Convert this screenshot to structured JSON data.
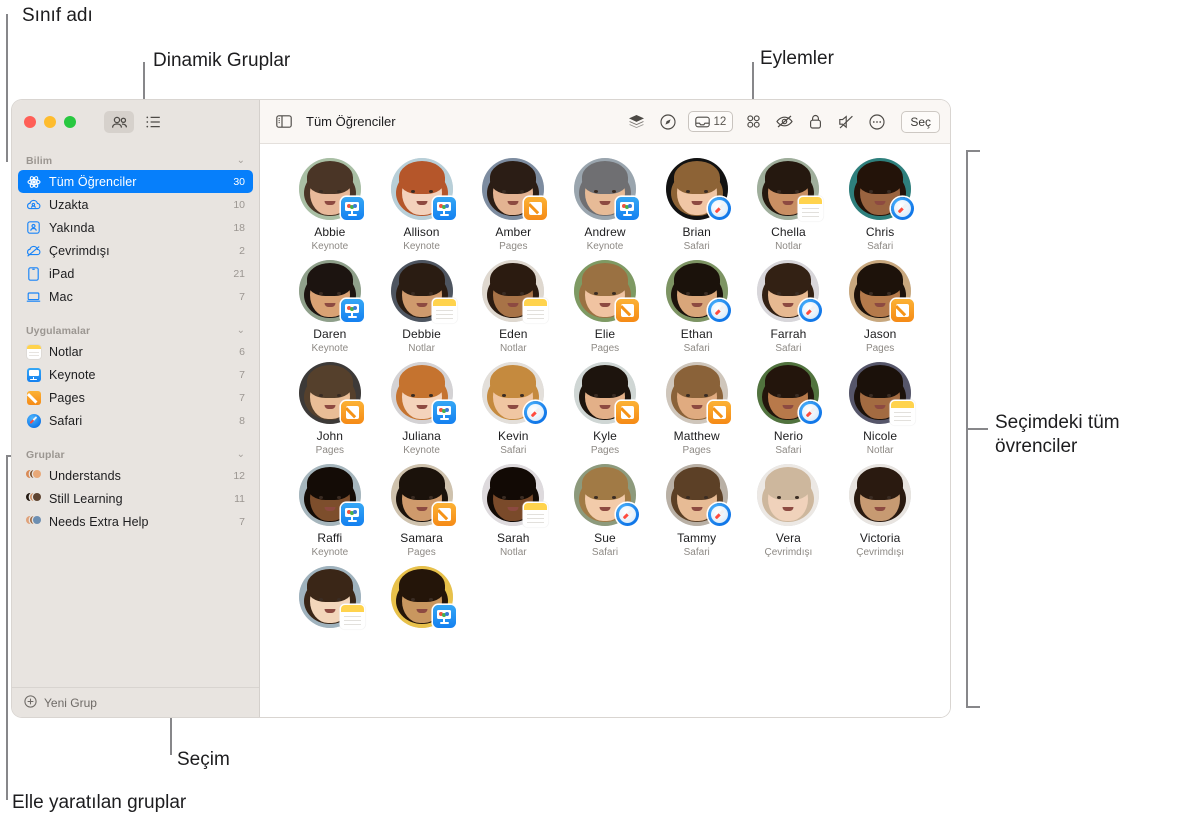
{
  "callouts": [
    {
      "id": "class-name",
      "text": "Sınıf adı"
    },
    {
      "id": "dynamic-groups",
      "text": "Dinamik Gruplar"
    },
    {
      "id": "actions",
      "text": "Eylemler"
    },
    {
      "id": "all-students-in-selection",
      "text": "Seçimdeki tüm\növrenciler"
    },
    {
      "id": "selection",
      "text": "Seçim"
    },
    {
      "id": "manual-groups",
      "text": "Elle yaratılan gruplar"
    }
  ],
  "callout_text": {
    "class_name": "Sınıf adı",
    "dynamic_groups": "Dinamik Gruplar",
    "actions": "Eylemler",
    "all_students": "Seçimdeki tüm\növrenciler",
    "selection": "Seçim",
    "manual_groups": "Elle yaratılan gruplar"
  },
  "sidebar": {
    "view_toggle": {
      "grid_icon": "people-icon",
      "list_icon": "list-icon"
    },
    "sections": [
      {
        "title": "Bilim",
        "items": [
          {
            "label": "Tüm Öğrenciler",
            "count": "30",
            "icon": "atom-icon",
            "selected": true
          },
          {
            "label": "Uzakta",
            "count": "10",
            "icon": "cloud-person-icon",
            "selected": false
          },
          {
            "label": "Yakında",
            "count": "18",
            "icon": "person-box-icon",
            "selected": false
          },
          {
            "label": "Çevrimdışı",
            "count": "2",
            "icon": "cloud-slash-icon",
            "selected": false
          },
          {
            "label": "iPad",
            "count": "21",
            "icon": "ipad-icon",
            "selected": false
          },
          {
            "label": "Mac",
            "count": "7",
            "icon": "laptop-icon",
            "selected": false
          }
        ]
      },
      {
        "title": "Uygulamalar",
        "items": [
          {
            "label": "Notlar",
            "count": "6",
            "icon": "notes-app-icon",
            "selected": false
          },
          {
            "label": "Keynote",
            "count": "7",
            "icon": "keynote-app-icon",
            "selected": false
          },
          {
            "label": "Pages",
            "count": "7",
            "icon": "pages-app-icon",
            "selected": false
          },
          {
            "label": "Safari",
            "count": "8",
            "icon": "safari-app-icon",
            "selected": false
          }
        ]
      },
      {
        "title": "Gruplar",
        "items": [
          {
            "label": "Understands",
            "count": "12",
            "icon": "group-avatars-icon",
            "selected": false
          },
          {
            "label": "Still Learning",
            "count": "11",
            "icon": "group-avatars-icon",
            "selected": false
          },
          {
            "label": "Needs Extra Help",
            "count": "7",
            "icon": "group-avatars-icon",
            "selected": false
          }
        ]
      }
    ],
    "new_group_label": "Yeni Grup",
    "new_group_icon": "plus-circle-icon"
  },
  "toolbar": {
    "sidebar_toggle_icon": "sidebar-icon",
    "title": "Tüm Öğrenciler",
    "actions": [
      {
        "name": "layers-icon",
        "label": ""
      },
      {
        "name": "navigate-icon",
        "label": ""
      },
      {
        "name": "inbox-icon",
        "label": "12"
      },
      {
        "name": "apps-grid-icon",
        "label": ""
      },
      {
        "name": "eye-slash-icon",
        "label": ""
      },
      {
        "name": "lock-icon",
        "label": ""
      },
      {
        "name": "mute-icon",
        "label": ""
      },
      {
        "name": "more-icon",
        "label": ""
      }
    ],
    "select_label": "Seç"
  },
  "students": [
    {
      "name": "Abbie",
      "app": "Keynote",
      "badge": "keynote",
      "skin": "#e8b99a",
      "hair": "#4a3526",
      "bg": "#a9bfa4"
    },
    {
      "name": "Allison",
      "app": "Keynote",
      "badge": "keynote",
      "skin": "#f3d2bc",
      "hair": "#b5562a",
      "bg": "#b8cfd8"
    },
    {
      "name": "Amber",
      "app": "Pages",
      "badge": "pages",
      "skin": "#e3b392",
      "hair": "#2b1d15",
      "bg": "#7d8ca0"
    },
    {
      "name": "Andrew",
      "app": "Keynote",
      "badge": "keynote",
      "skin": "#e7bb97",
      "hair": "#6f6f72",
      "bg": "#9aa5ae"
    },
    {
      "name": "Brian",
      "app": "Safari",
      "badge": "safari",
      "skin": "#f0c6a5",
      "hair": "#8d6336",
      "bg": "#121212"
    },
    {
      "name": "Chella",
      "app": "Notlar",
      "badge": "notes",
      "skin": "#c98f63",
      "hair": "#25180f",
      "bg": "#9fae9b"
    },
    {
      "name": "Chris",
      "app": "Safari",
      "badge": "safari",
      "skin": "#9a6440",
      "hair": "#231309",
      "bg": "#2e7f7c"
    },
    {
      "name": "Daren",
      "app": "Keynote",
      "badge": "keynote",
      "skin": "#d9a274",
      "hair": "#1c1410",
      "bg": "#8fa08a"
    },
    {
      "name": "Debbie",
      "app": "Notlar",
      "badge": "notes",
      "skin": "#cf9a6d",
      "hair": "#2a1c12",
      "bg": "#4e5560"
    },
    {
      "name": "Eden",
      "app": "Notlar",
      "badge": "notes",
      "skin": "#a87347",
      "hair": "#2b1b10",
      "bg": "#dfd8cf"
    },
    {
      "name": "Elie",
      "app": "Pages",
      "badge": "pages",
      "skin": "#f0c3a1",
      "hair": "#9a7142",
      "bg": "#7e9a63"
    },
    {
      "name": "Ethan",
      "app": "Safari",
      "badge": "safari",
      "skin": "#d9a67a",
      "hair": "#1b120b",
      "bg": "#7d9463"
    },
    {
      "name": "Farrah",
      "app": "Safari",
      "badge": "safari",
      "skin": "#e7b991",
      "hair": "#332114",
      "bg": "#d8d6da"
    },
    {
      "name": "Jason",
      "app": "Pages",
      "badge": "pages",
      "skin": "#b57a4b",
      "hair": "#1d120a",
      "bg": "#c9a87e"
    },
    {
      "name": "John",
      "app": "Pages",
      "badge": "pages",
      "skin": "#e9bd96",
      "hair": "#55402c",
      "bg": "#3d3a38"
    },
    {
      "name": "Juliana",
      "app": "Keynote",
      "badge": "keynote",
      "skin": "#f4d3bb",
      "hair": "#c5732f",
      "bg": "#d4d2d4"
    },
    {
      "name": "Kevin",
      "app": "Safari",
      "badge": "safari",
      "skin": "#f0c6a2",
      "hair": "#c58a3e",
      "bg": "#e3dfda"
    },
    {
      "name": "Kyle",
      "app": "Pages",
      "badge": "pages",
      "skin": "#e3b088",
      "hair": "#1d140d",
      "bg": "#cfd6d4"
    },
    {
      "name": "Matthew",
      "app": "Pages",
      "badge": "pages",
      "skin": "#e0ab80",
      "hair": "#8a6239",
      "bg": "#cfc6bb"
    },
    {
      "name": "Nerio",
      "app": "Safari",
      "badge": "safari",
      "skin": "#b8794a",
      "hair": "#23150c",
      "bg": "#51733e"
    },
    {
      "name": "Nicole",
      "app": "Notlar",
      "badge": "notes",
      "skin": "#a36b41",
      "hair": "#1b110a",
      "bg": "#56566a"
    },
    {
      "name": "Raffi",
      "app": "Keynote",
      "badge": "keynote",
      "skin": "#7d4e2c",
      "hair": "#140c06",
      "bg": "#a6b6bd"
    },
    {
      "name": "Samara",
      "app": "Pages",
      "badge": "pages",
      "skin": "#cf9a6c",
      "hair": "#1b120b",
      "bg": "#cfc2ad"
    },
    {
      "name": "Sarah",
      "app": "Notlar",
      "badge": "notes",
      "skin": "#7a4a2a",
      "hair": "#120a05",
      "bg": "#dedadd"
    },
    {
      "name": "Sue",
      "app": "Safari",
      "badge": "safari",
      "skin": "#f2cbaa",
      "hair": "#a17a45",
      "bg": "#8d9a7c"
    },
    {
      "name": "Tammy",
      "app": "Safari",
      "badge": "safari",
      "skin": "#e7bb95",
      "hair": "#5c4026",
      "bg": "#b9b0a5"
    },
    {
      "name": "Vera",
      "app": "Çevrimdışı",
      "badge": "none",
      "skin": "#f0d2bb",
      "hair": "#cdb79d",
      "bg": "#ece8e4"
    },
    {
      "name": "Victoria",
      "app": "Çevrimdışı",
      "badge": "none",
      "skin": "#c79a72",
      "hair": "#2a1a10",
      "bg": "#e8e4e0"
    },
    {
      "name": "",
      "app": "",
      "badge": "notes",
      "skin": "#f3d6bb",
      "hair": "#3a2617",
      "bg": "#9fb2bd"
    },
    {
      "name": "",
      "app": "",
      "badge": "keynote",
      "skin": "#c9975f",
      "hair": "#241509",
      "bg": "#e8c14a"
    }
  ],
  "colors": {
    "accent": "#067ffb",
    "sidebar_bg": "#e8e4e0",
    "toolbar_bg": "#faf7f4",
    "rule": "#87878a"
  }
}
